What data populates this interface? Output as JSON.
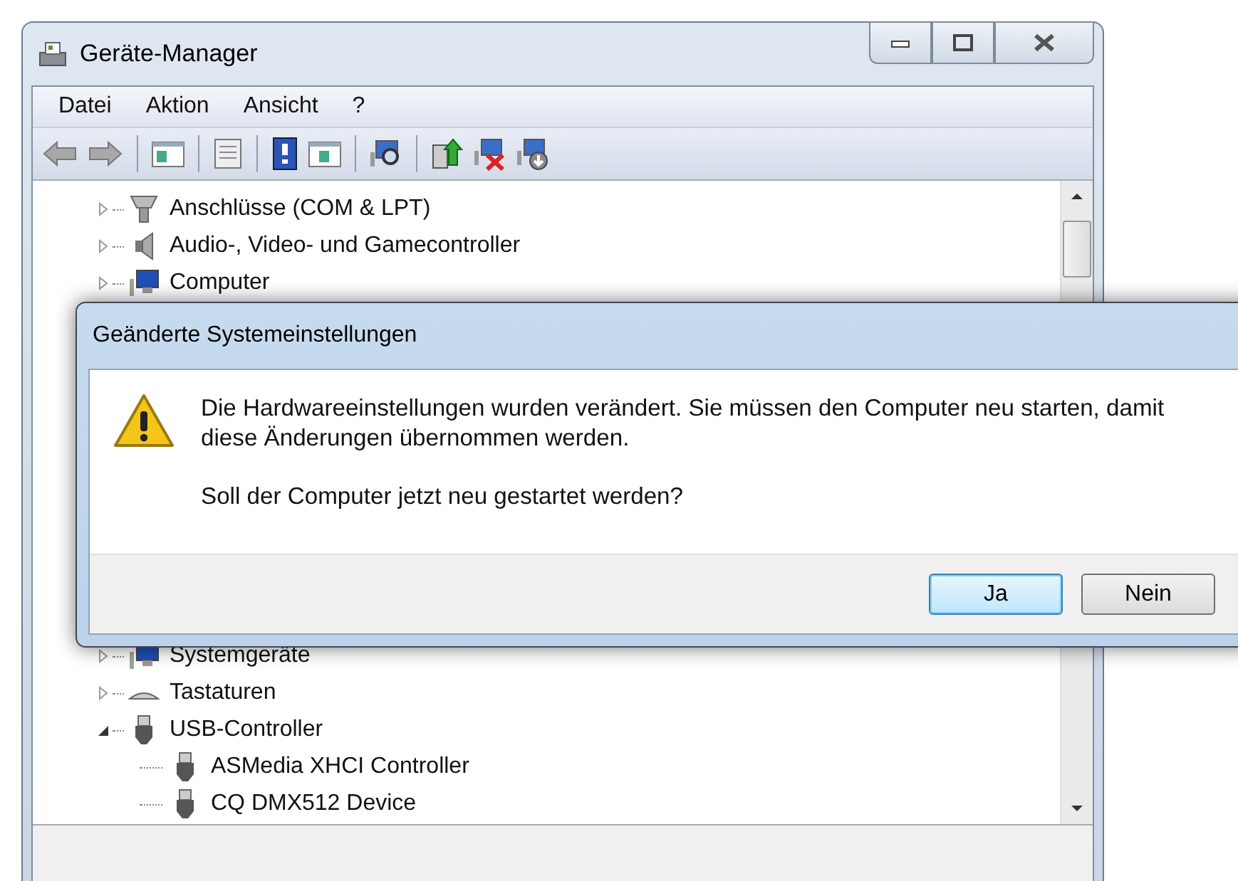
{
  "window": {
    "title": "Geräte-Manager"
  },
  "menu": [
    "Datei",
    "Aktion",
    "Ansicht",
    "?"
  ],
  "tree": [
    {
      "label": "Anschlüsse (COM & LPT)",
      "kind": "port",
      "expanded": false
    },
    {
      "label": "Audio-, Video- und Gamecontroller",
      "kind": "speaker",
      "expanded": false
    },
    {
      "label": "Computer",
      "kind": "monitor",
      "expanded": false
    },
    {
      "label": "Systemgeräte",
      "kind": "monitor",
      "expanded": false
    },
    {
      "label": "Tastaturen",
      "kind": "keyboard",
      "expanded": false
    },
    {
      "label": "USB-Controller",
      "kind": "usb",
      "expanded": true,
      "children": [
        {
          "label": "ASMedia XHCI Controller",
          "kind": "usb"
        },
        {
          "label": "CQ DMX512 Device",
          "kind": "usb"
        }
      ]
    }
  ],
  "dialog": {
    "title": "Geänderte Systemeinstellungen",
    "message": "Die Hardwareeinstellungen wurden verändert. Sie müssen den Computer neu starten, damit diese Änderungen übernommen werden.",
    "question": "Soll der Computer jetzt neu gestartet werden?",
    "buttons": [
      {
        "label": "Ja",
        "selected": true
      },
      {
        "label": "Nein",
        "selected": false
      }
    ]
  }
}
